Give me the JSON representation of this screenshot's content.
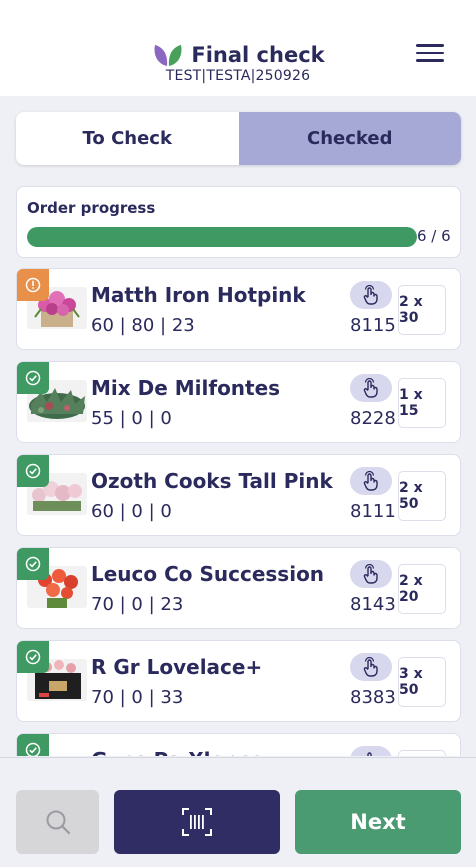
{
  "header": {
    "title": "Final check",
    "subtitle": "TEST|TESTA|250926",
    "icons": {
      "logo": "leaf-logo-icon",
      "menu": "hamburger-menu-icon"
    }
  },
  "tabs": [
    {
      "label": "To Check",
      "active": false
    },
    {
      "label": "Checked",
      "active": true
    }
  ],
  "progress": {
    "label": "Order progress",
    "count": "6 / 6",
    "fraction": 1.0
  },
  "items": [
    {
      "name": "Matth Iron Hotpink",
      "stats": "60 | 80 | 23",
      "code": "8115",
      "qty": "2 x 30",
      "status": "warning"
    },
    {
      "name": "Mix De Milfontes",
      "stats": "55 | 0 | 0",
      "code": "8228",
      "qty": "1 x 15",
      "status": "checked"
    },
    {
      "name": "Ozoth Cooks Tall Pink",
      "stats": "60 | 0 | 0",
      "code": "8111",
      "qty": "2 x 50",
      "status": "checked"
    },
    {
      "name": "Leuco Co Succession",
      "stats": "70 | 0 | 23",
      "code": "8143",
      "qty": "2 x 20",
      "status": "checked"
    },
    {
      "name": "R Gr Lovelace+",
      "stats": "70 | 0 | 33",
      "code": "8383",
      "qty": "3 x 50",
      "status": "checked"
    },
    {
      "name": "Gyps Pa Xlence",
      "stats": "",
      "code": "",
      "qty": "",
      "status": "checked"
    }
  ],
  "footer": {
    "next_label": "Next",
    "icons": {
      "search": "search-icon",
      "scan": "barcode-scan-icon"
    }
  },
  "colors": {
    "navy": "#2b2a5c",
    "green": "#3e9a62",
    "warning": "#e8904a",
    "tab_active": "#a6a8d6"
  }
}
